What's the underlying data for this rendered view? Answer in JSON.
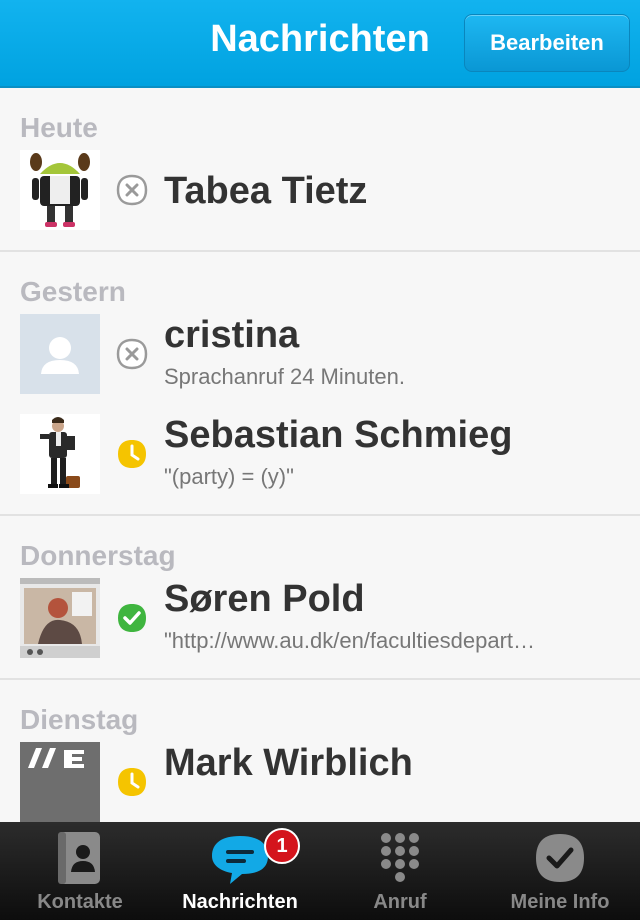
{
  "header": {
    "title": "Nachrichten",
    "edit_label": "Bearbeiten"
  },
  "sections": [
    {
      "title": "Heute",
      "items": [
        {
          "name": "Tabea Tietz",
          "subtitle": "",
          "status": "offline"
        }
      ]
    },
    {
      "title": "Gestern",
      "items": [
        {
          "name": "cristina",
          "subtitle": "Sprachanruf  24 Minuten.",
          "status": "offline"
        },
        {
          "name": "Sebastian Schmieg",
          "subtitle": "\"(party) = (y)\"",
          "status": "away"
        }
      ]
    },
    {
      "title": "Donnerstag",
      "items": [
        {
          "name": "Søren Pold",
          "subtitle": "\"http://www.au.dk/en/facultiesdepart…",
          "status": "online"
        }
      ]
    },
    {
      "title": "Dienstag",
      "items": [
        {
          "name": "Mark Wirblich",
          "subtitle": "",
          "status": "away"
        }
      ]
    }
  ],
  "tabbar": {
    "tabs": [
      {
        "label": "Kontakte",
        "icon": "contacts-icon"
      },
      {
        "label": "Nachrichten",
        "icon": "chat-bubble-icon",
        "badge": "1",
        "active": true
      },
      {
        "label": "Anruf",
        "icon": "dialpad-icon"
      },
      {
        "label": "Meine Info",
        "icon": "skype-check-icon"
      }
    ]
  },
  "colors": {
    "header_blue": "#00a2e0",
    "online": "#3fb53f",
    "away": "#f5c400",
    "offline": "#9a9a9a",
    "badge": "#d4141c"
  }
}
